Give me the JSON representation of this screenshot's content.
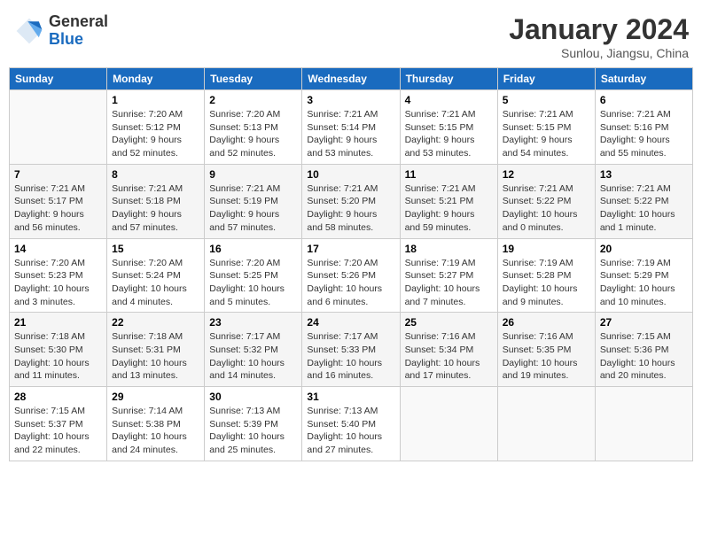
{
  "header": {
    "logo": {
      "general": "General",
      "blue": "Blue"
    },
    "title": "January 2024",
    "location": "Sunlou, Jiangsu, China"
  },
  "calendar": {
    "days_of_week": [
      "Sunday",
      "Monday",
      "Tuesday",
      "Wednesday",
      "Thursday",
      "Friday",
      "Saturday"
    ],
    "weeks": [
      [
        {
          "day": "",
          "info": ""
        },
        {
          "day": "1",
          "info": "Sunrise: 7:20 AM\nSunset: 5:12 PM\nDaylight: 9 hours\nand 52 minutes."
        },
        {
          "day": "2",
          "info": "Sunrise: 7:20 AM\nSunset: 5:13 PM\nDaylight: 9 hours\nand 52 minutes."
        },
        {
          "day": "3",
          "info": "Sunrise: 7:21 AM\nSunset: 5:14 PM\nDaylight: 9 hours\nand 53 minutes."
        },
        {
          "day": "4",
          "info": "Sunrise: 7:21 AM\nSunset: 5:15 PM\nDaylight: 9 hours\nand 53 minutes."
        },
        {
          "day": "5",
          "info": "Sunrise: 7:21 AM\nSunset: 5:15 PM\nDaylight: 9 hours\nand 54 minutes."
        },
        {
          "day": "6",
          "info": "Sunrise: 7:21 AM\nSunset: 5:16 PM\nDaylight: 9 hours\nand 55 minutes."
        }
      ],
      [
        {
          "day": "7",
          "info": "Sunrise: 7:21 AM\nSunset: 5:17 PM\nDaylight: 9 hours\nand 56 minutes."
        },
        {
          "day": "8",
          "info": "Sunrise: 7:21 AM\nSunset: 5:18 PM\nDaylight: 9 hours\nand 57 minutes."
        },
        {
          "day": "9",
          "info": "Sunrise: 7:21 AM\nSunset: 5:19 PM\nDaylight: 9 hours\nand 57 minutes."
        },
        {
          "day": "10",
          "info": "Sunrise: 7:21 AM\nSunset: 5:20 PM\nDaylight: 9 hours\nand 58 minutes."
        },
        {
          "day": "11",
          "info": "Sunrise: 7:21 AM\nSunset: 5:21 PM\nDaylight: 9 hours\nand 59 minutes."
        },
        {
          "day": "12",
          "info": "Sunrise: 7:21 AM\nSunset: 5:22 PM\nDaylight: 10 hours\nand 0 minutes."
        },
        {
          "day": "13",
          "info": "Sunrise: 7:21 AM\nSunset: 5:22 PM\nDaylight: 10 hours\nand 1 minute."
        }
      ],
      [
        {
          "day": "14",
          "info": "Sunrise: 7:20 AM\nSunset: 5:23 PM\nDaylight: 10 hours\nand 3 minutes."
        },
        {
          "day": "15",
          "info": "Sunrise: 7:20 AM\nSunset: 5:24 PM\nDaylight: 10 hours\nand 4 minutes."
        },
        {
          "day": "16",
          "info": "Sunrise: 7:20 AM\nSunset: 5:25 PM\nDaylight: 10 hours\nand 5 minutes."
        },
        {
          "day": "17",
          "info": "Sunrise: 7:20 AM\nSunset: 5:26 PM\nDaylight: 10 hours\nand 6 minutes."
        },
        {
          "day": "18",
          "info": "Sunrise: 7:19 AM\nSunset: 5:27 PM\nDaylight: 10 hours\nand 7 minutes."
        },
        {
          "day": "19",
          "info": "Sunrise: 7:19 AM\nSunset: 5:28 PM\nDaylight: 10 hours\nand 9 minutes."
        },
        {
          "day": "20",
          "info": "Sunrise: 7:19 AM\nSunset: 5:29 PM\nDaylight: 10 hours\nand 10 minutes."
        }
      ],
      [
        {
          "day": "21",
          "info": "Sunrise: 7:18 AM\nSunset: 5:30 PM\nDaylight: 10 hours\nand 11 minutes."
        },
        {
          "day": "22",
          "info": "Sunrise: 7:18 AM\nSunset: 5:31 PM\nDaylight: 10 hours\nand 13 minutes."
        },
        {
          "day": "23",
          "info": "Sunrise: 7:17 AM\nSunset: 5:32 PM\nDaylight: 10 hours\nand 14 minutes."
        },
        {
          "day": "24",
          "info": "Sunrise: 7:17 AM\nSunset: 5:33 PM\nDaylight: 10 hours\nand 16 minutes."
        },
        {
          "day": "25",
          "info": "Sunrise: 7:16 AM\nSunset: 5:34 PM\nDaylight: 10 hours\nand 17 minutes."
        },
        {
          "day": "26",
          "info": "Sunrise: 7:16 AM\nSunset: 5:35 PM\nDaylight: 10 hours\nand 19 minutes."
        },
        {
          "day": "27",
          "info": "Sunrise: 7:15 AM\nSunset: 5:36 PM\nDaylight: 10 hours\nand 20 minutes."
        }
      ],
      [
        {
          "day": "28",
          "info": "Sunrise: 7:15 AM\nSunset: 5:37 PM\nDaylight: 10 hours\nand 22 minutes."
        },
        {
          "day": "29",
          "info": "Sunrise: 7:14 AM\nSunset: 5:38 PM\nDaylight: 10 hours\nand 24 minutes."
        },
        {
          "day": "30",
          "info": "Sunrise: 7:13 AM\nSunset: 5:39 PM\nDaylight: 10 hours\nand 25 minutes."
        },
        {
          "day": "31",
          "info": "Sunrise: 7:13 AM\nSunset: 5:40 PM\nDaylight: 10 hours\nand 27 minutes."
        },
        {
          "day": "",
          "info": ""
        },
        {
          "day": "",
          "info": ""
        },
        {
          "day": "",
          "info": ""
        }
      ]
    ]
  }
}
